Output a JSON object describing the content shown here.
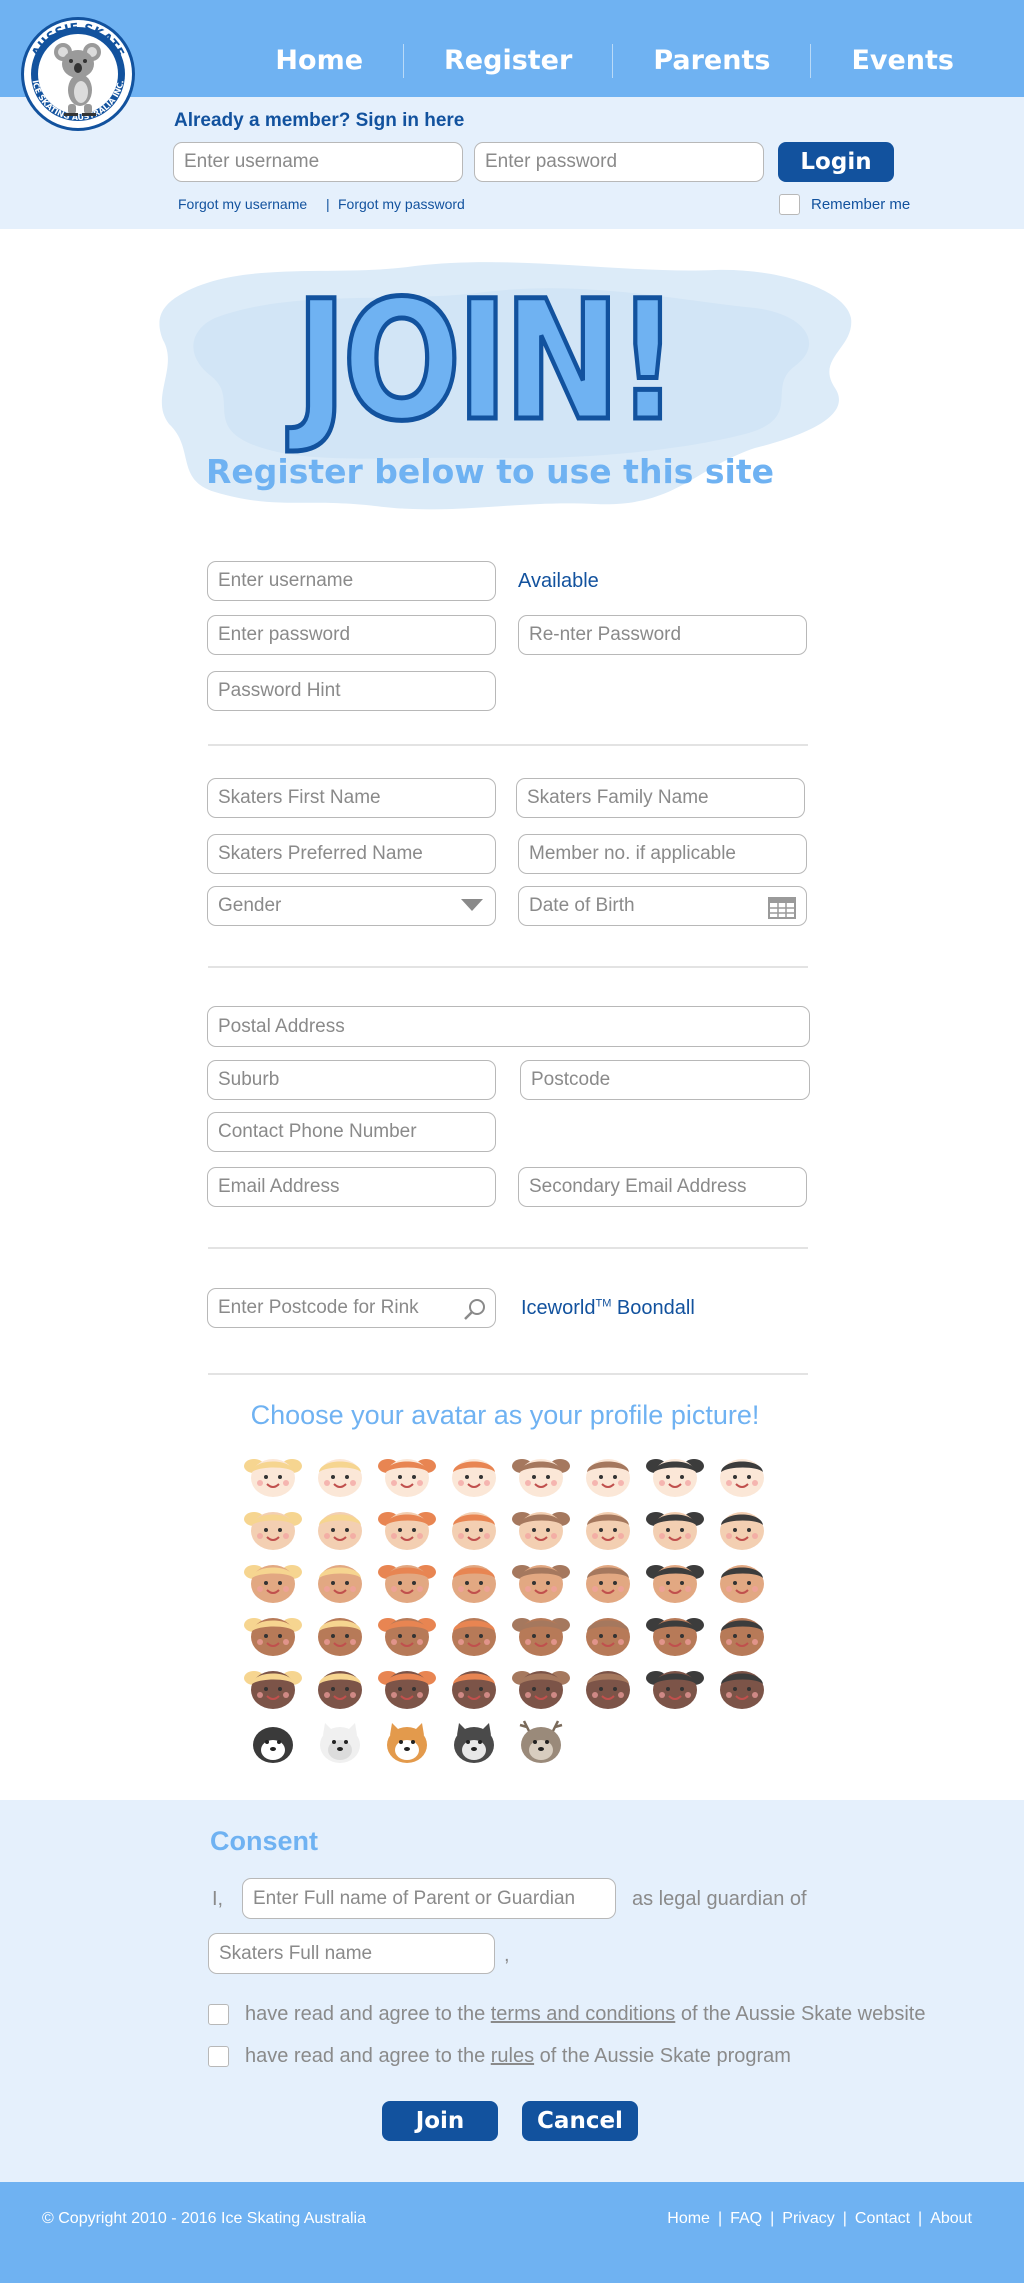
{
  "nav": {
    "items": [
      "Home",
      "Register",
      "Parents",
      "Events"
    ]
  },
  "logo": {
    "top_text": "AUSSIE SKATE",
    "ring_text": "ICE SKATING AUSTRALIA INC."
  },
  "signin": {
    "title": "Already a member? Sign in here",
    "username_placeholder": "Enter username",
    "password_placeholder": "Enter password",
    "login_label": "Login",
    "forgot_username": "Forgot my username",
    "link_separator": "|",
    "forgot_password": "Forgot my password",
    "remember_label": "Remember me"
  },
  "hero": {
    "join_text": "JOIN!",
    "subtitle": "Register below to use this site"
  },
  "account": {
    "username_placeholder": "Enter username",
    "username_status": "Available",
    "password_placeholder": "Enter password",
    "reenter_placeholder": "Re-nter Password",
    "hint_placeholder": "Password Hint"
  },
  "skater": {
    "first_name": "Skaters First Name",
    "family_name": "Skaters Family Name",
    "preferred_name": "Skaters Preferred Name",
    "member_no": "Member no. if applicable",
    "gender": "Gender",
    "dob": "Date of Birth"
  },
  "contact": {
    "postal": "Postal Address",
    "suburb": "Suburb",
    "postcode": "Postcode",
    "phone": "Contact Phone Number",
    "email": "Email Address",
    "email2": "Secondary Email Address"
  },
  "rink": {
    "search_placeholder": "Enter Postcode for Rink",
    "result_name": "Iceworld",
    "result_tm": "TM",
    "result_place": " Boondall"
  },
  "avatars": {
    "title": "Choose your avatar as your profile picture!",
    "skin_tones": [
      "#fbe7d7",
      "#f3cfb2",
      "#e2a882",
      "#b77a58",
      "#7c5448"
    ],
    "hair_colors": [
      "#f6d590",
      "#f6d590",
      "#e88552",
      "#e88552",
      "#a5785e",
      "#a5785e",
      "#3c3c3c",
      "#3c3c3c"
    ],
    "animals": [
      "penguin-icon",
      "polar-bear-icon",
      "fox-icon",
      "husky-icon",
      "reindeer-icon"
    ]
  },
  "consent": {
    "title": "Consent",
    "i_label": "I,",
    "guardian_placeholder": "Enter Full name of Parent or Guardian",
    "legal_text": "as legal guardian of",
    "skater_placeholder": "Skaters Full name",
    "comma": ",",
    "agree_prefix": "have read and agree to the",
    "terms_link": "terms and conditions",
    "terms_suffix": "of the Aussie Skate website",
    "rules_link": "rules",
    "rules_suffix": "of the Aussie Skate program",
    "join_label": "Join",
    "cancel_label": "Cancel"
  },
  "footer": {
    "copyright": "© Copyright 2010 - 2016 Ice Skating Australia",
    "links": [
      "Home",
      "FAQ",
      "Privacy",
      "Contact",
      "About"
    ],
    "separator": "|"
  },
  "colors": {
    "brand_dark": "#12529e",
    "brand_light": "#6fb2f2",
    "panel": "#e5f0fc"
  }
}
